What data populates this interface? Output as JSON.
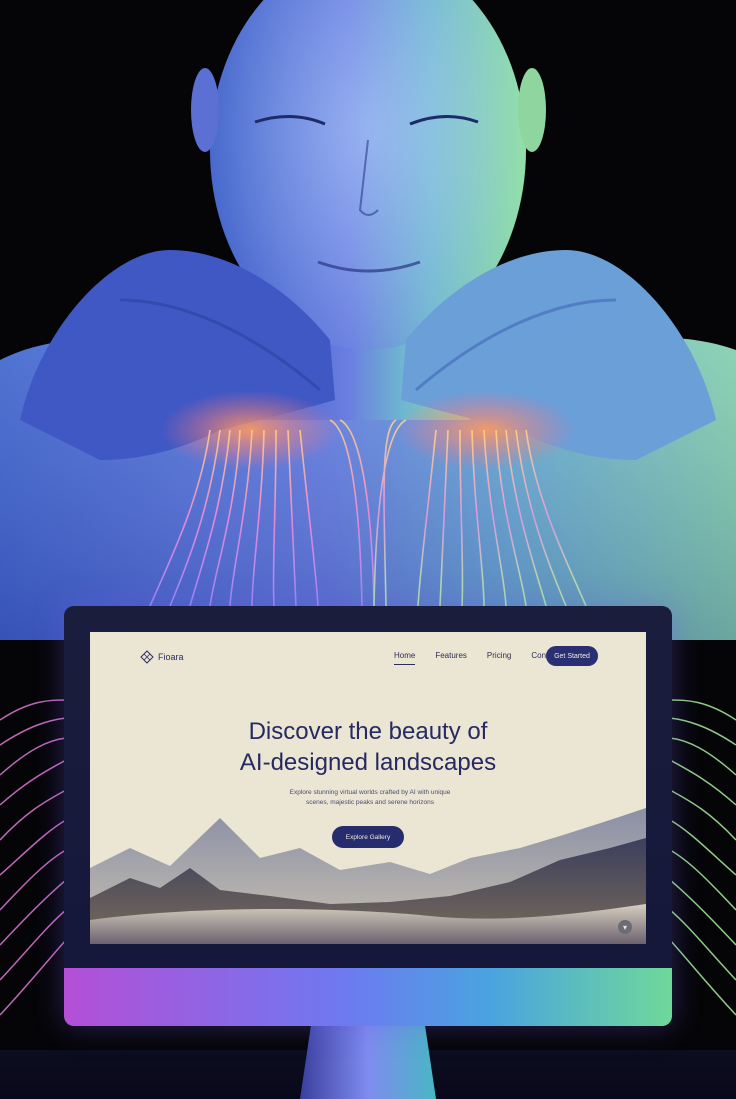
{
  "site": {
    "logo_text": "Fioara",
    "nav": [
      "Home",
      "Features",
      "Pricing",
      "Contact"
    ],
    "nav_cta": "Get Started",
    "hero_title_line1": "Discover the beauty of",
    "hero_title_line2": "AI-designed landscapes",
    "hero_sub_line1": "Explore stunning virtual worlds crafted by AI with unique",
    "hero_sub_line2": "scenes, majestic peaks and serene horizons",
    "hero_cta": "Explore Gallery"
  },
  "colors": {
    "screen_bg": "#ebe5d3",
    "accent": "#262c6e",
    "figure_skin_blue": "#5f78d6",
    "figure_skin_green": "#7fd5a4",
    "fiber_pink": "#f07ad0",
    "fiber_orange": "#ffb066",
    "fiber_green": "#b7f29a"
  },
  "icons": {
    "logo": "diamond-grid-logo-icon",
    "scroll": "chevron-down-icon"
  }
}
